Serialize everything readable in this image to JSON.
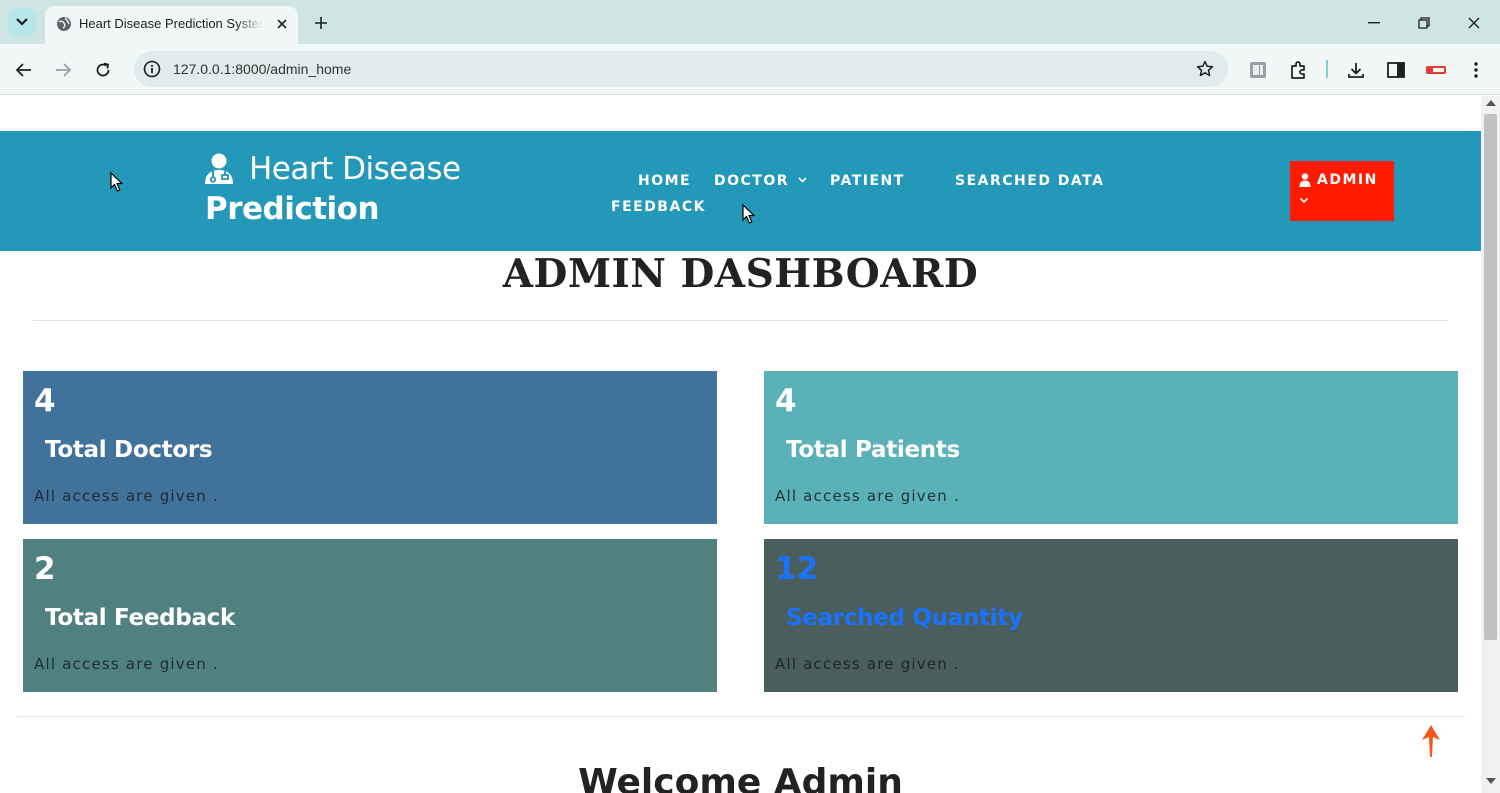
{
  "browser": {
    "tab_title": "Heart Disease Prediction System",
    "url": "127.0.0.1:8000/admin_home"
  },
  "header": {
    "logo_line1": "Heart Disease",
    "logo_line2": "Prediction",
    "nav": {
      "home": "HOME",
      "doctor": "DOCTOR",
      "patient": "PATIENT",
      "searched_data": "SEARCHED DATA",
      "feedback": "FEEDBACK"
    },
    "admin_label": "ADMIN"
  },
  "page_title": "ADMIN DASHBOARD",
  "colors": {
    "header": "#2398b9",
    "admin_button": "#ff1a00",
    "card_doctors": "#41729b",
    "card_patients": "#5ab1b7",
    "card_feedback": "#508180",
    "card_searched": "#4a5e5d",
    "highlight_text": "#1a73ff"
  },
  "cards": [
    {
      "count": "4",
      "label": "Total Doctors",
      "note": "All access are given ."
    },
    {
      "count": "4",
      "label": "Total Patients",
      "note": "All access are given ."
    },
    {
      "count": "2",
      "label": "Total Feedback",
      "note": "All access are given ."
    },
    {
      "count": "12",
      "label": "Searched Quantity",
      "note": "All access are given ."
    }
  ],
  "welcome": "Welcome Admin"
}
